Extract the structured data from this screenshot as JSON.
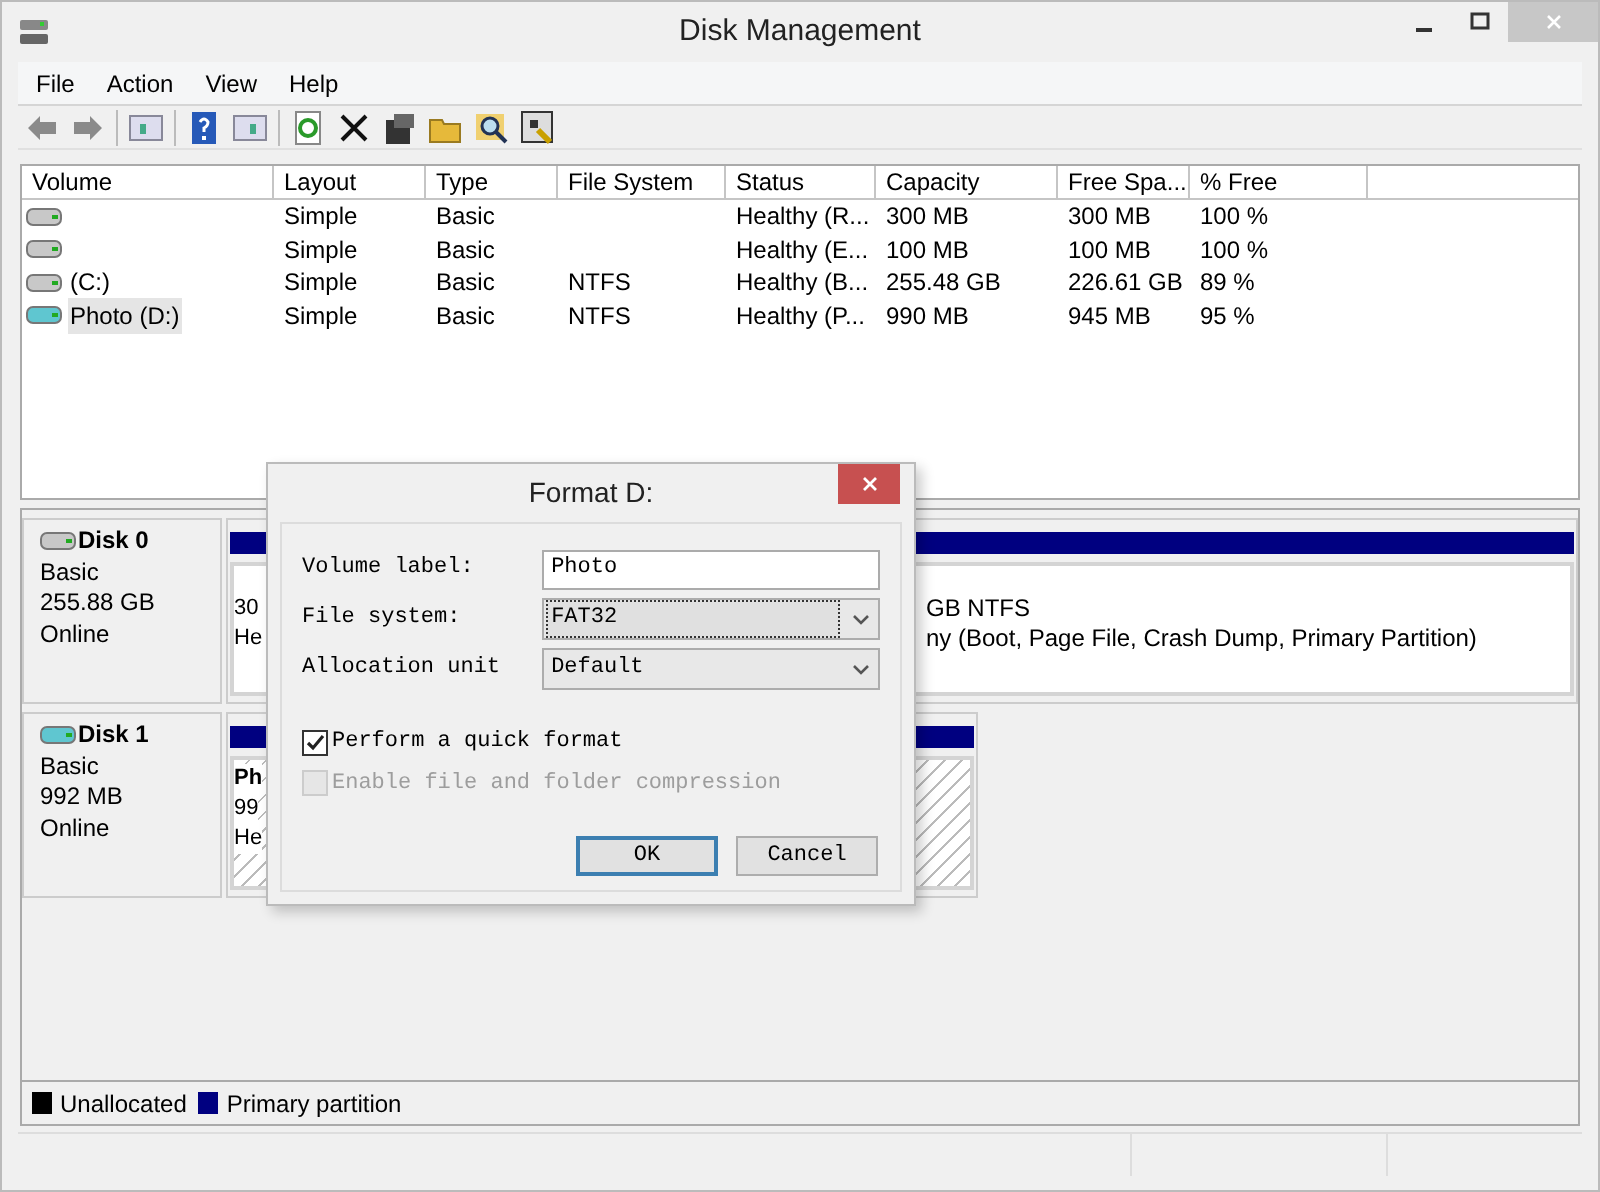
{
  "window": {
    "title": "Disk Management"
  },
  "menu": [
    "File",
    "Action",
    "View",
    "Help"
  ],
  "volumes": {
    "columns": [
      "Volume",
      "Layout",
      "Type",
      "File System",
      "Status",
      "Capacity",
      "Free Spa...",
      "% Free"
    ],
    "rows": [
      {
        "kind": "disk",
        "selected": false,
        "cells": [
          "",
          "Simple",
          "Basic",
          "",
          "Healthy (R...",
          "300 MB",
          "300 MB",
          "100 %"
        ]
      },
      {
        "kind": "disk",
        "selected": false,
        "cells": [
          "",
          "Simple",
          "Basic",
          "",
          "Healthy (E...",
          "100 MB",
          "100 MB",
          "100 %"
        ]
      },
      {
        "kind": "disk",
        "selected": false,
        "cells": [
          "(C:)",
          "Simple",
          "Basic",
          "NTFS",
          "Healthy (B...",
          "255.48 GB",
          "226.61 GB",
          "89 %"
        ]
      },
      {
        "kind": "removable",
        "selected": true,
        "cells": [
          "Photo (D:)",
          "Simple",
          "Basic",
          "NTFS",
          "Healthy (P...",
          "990 MB",
          "945 MB",
          "95 %"
        ]
      }
    ]
  },
  "disks": [
    {
      "kind": "disk",
      "name": "Disk 0",
      "lines": [
        "Basic",
        "255.88 GB",
        "Online"
      ],
      "left_fragments": [
        "30",
        "He"
      ],
      "right_fragments": [
        "GB NTFS",
        "ny (Boot, Page File, Crash Dump, Primary Partition)"
      ]
    },
    {
      "kind": "removable",
      "name": "Disk 1",
      "lines": [
        "Basic",
        "992 MB",
        "Online"
      ],
      "left_fragments": [
        "Ph",
        "99",
        "He"
      ]
    }
  ],
  "legend": [
    {
      "label": "Unallocated",
      "color": "#000000"
    },
    {
      "label": "Primary partition",
      "color": "#000080"
    }
  ],
  "dialog": {
    "title": "Format D:",
    "fields": [
      {
        "label": "Volume label:",
        "kind": "text",
        "value": "Photo"
      },
      {
        "label": "File system:",
        "kind": "dropdown",
        "value": "FAT32",
        "focused": true
      },
      {
        "label": "Allocation unit",
        "kind": "dropdown",
        "value": "Default",
        "focused": false
      }
    ],
    "checkboxes": [
      {
        "label": "Perform a quick format",
        "checked": true,
        "disabled": false
      },
      {
        "label": "Enable file and folder compression",
        "checked": false,
        "disabled": true
      }
    ],
    "buttons": [
      {
        "label": "OK",
        "default": true
      },
      {
        "label": "Cancel",
        "default": false
      }
    ]
  }
}
